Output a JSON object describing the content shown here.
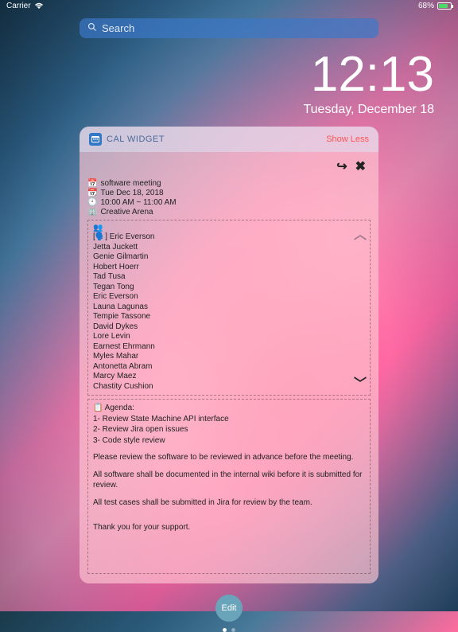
{
  "status": {
    "carrier": "Carrier",
    "battery_pct": "68%"
  },
  "search": {
    "placeholder": "Search"
  },
  "clock": {
    "time": "12:13",
    "date": "Tuesday, December 18"
  },
  "widget": {
    "app_name": "CAL WIDGET",
    "show_less": "Show Less",
    "meeting": {
      "title": "software meeting",
      "date": "Tue Dec 18, 2018",
      "time": "10:00 AM ~ 11:00 AM",
      "location": "Creative Arena"
    },
    "participant_talk": "[🗣️] Eric Everson",
    "participants": [
      "Jetta Juckett",
      "Genie Gilmartin",
      "Hobert Hoerr",
      "Tad Tusa",
      "Tegan Tong",
      "Eric Everson",
      "Launa Lagunas",
      "Tempie Tassone",
      "David Dykes",
      "Lore Levin",
      "Earnest Ehrmann",
      "Myles Mahar",
      "Antonetta Abram",
      "Marcy Maez",
      "Chastity Cushion"
    ],
    "agenda": {
      "header": "📋 Agenda:",
      "items": [
        "1- Review State Machine API interface",
        "2- Review Jira open issues",
        "3- Code style review"
      ],
      "para1": "Please review the software to be reviewed in advance before the meeting.",
      "para2": "All software shall be documented in the internal wiki before it is submitted for review.",
      "para3": "All test cases shall be submitted in Jira for review by the team.",
      "closing": "Thank you for your support."
    }
  },
  "edit_button": "Edit"
}
